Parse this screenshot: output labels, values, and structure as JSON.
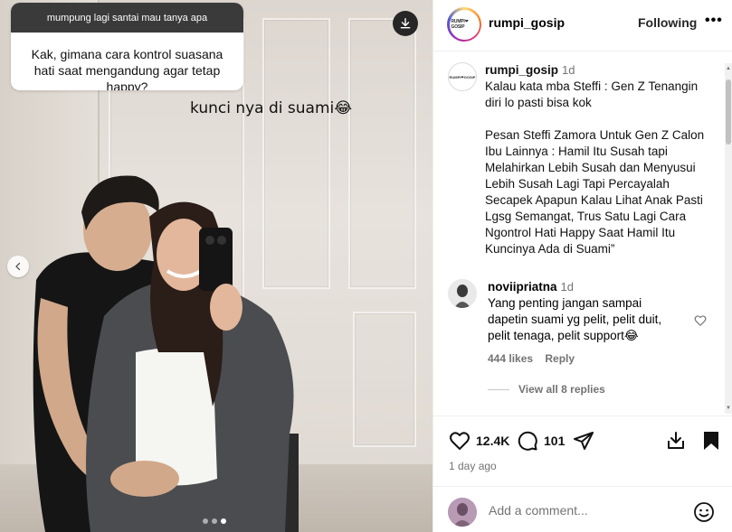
{
  "media": {
    "question_header": "mumpung lagi santai mau tanya apa",
    "question_text": "Kak, gimana cara kontrol suasana hati saat mengandung agar tetap happy?",
    "answer_text": "kunci nya di suami😂",
    "carousel": {
      "total": 3,
      "active_index": 2
    },
    "icons": {
      "download": "download-icon",
      "prev": "chevron-left-icon"
    }
  },
  "header": {
    "avatar_text": "RUMPI❤GOSIP",
    "username": "rumpi_gosip",
    "follow_label": "Following",
    "more_label": "•••"
  },
  "caption": {
    "username": "rumpi_gosip",
    "time": "1d",
    "lines": [
      "Kalau kata mba Steffi : Gen Z Tenangin",
      "diri lo pasti bisa kok",
      "",
      "Pesan Steffi Zamora Untuk Gen Z Calon",
      "Ibu Lainnya : Hamil Itu Susah tapi",
      "Melahirkan Lebih Susah dan Menyusui",
      "Lebih Susah Lagi Tapi Percayalah",
      "Secapek Apapun Kalau Lihat Anak Pasti",
      "Lgsg Semangat, Trus Satu Lagi Cara",
      "Ngontrol Hati Happy Saat Hamil Itu",
      "Kuncinya Ada di Suami”"
    ]
  },
  "comment": {
    "username": "noviipriatna",
    "time": "1d",
    "lines": [
      "Yang penting jangan sampai",
      "dapetin suami yg pelit, pelit duit,",
      "pelit tenaga, pelit support😂"
    ],
    "likes": "444 likes",
    "reply_label": "Reply",
    "view_replies": "View all 8 replies"
  },
  "actions": {
    "likes_count": "12.4K",
    "comments_count": "101",
    "date": "1 day ago"
  },
  "add_comment": {
    "placeholder": "Add a comment..."
  },
  "colors": {
    "text": "#000000",
    "muted": "#737373",
    "border": "#efefef"
  }
}
